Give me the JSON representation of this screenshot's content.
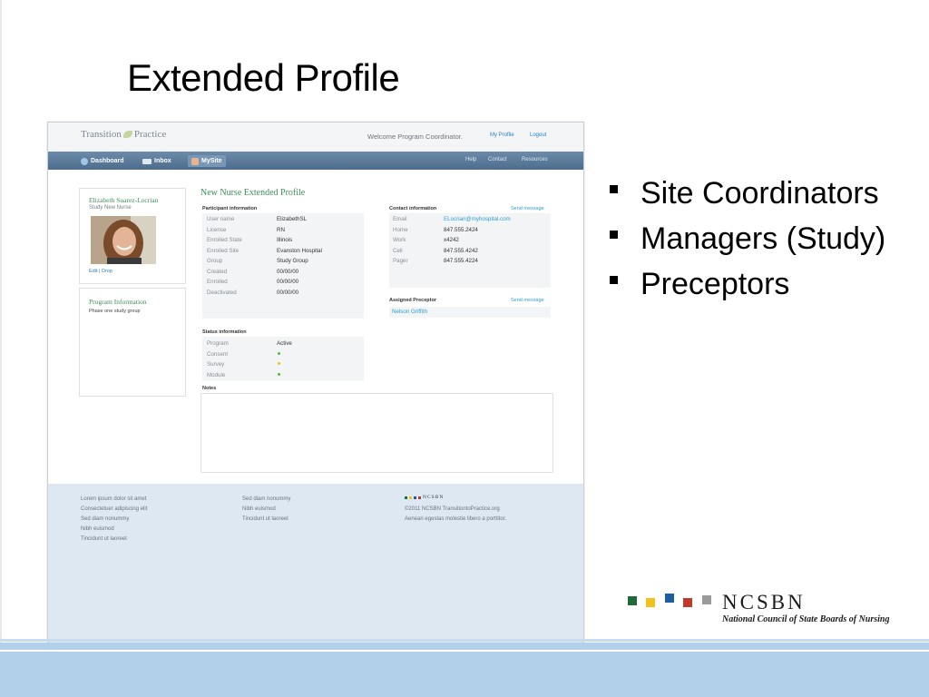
{
  "slide": {
    "title": "Extended Profile",
    "bullets": [
      "Site Coordinators",
      "Managers (Study)",
      "Preceptors"
    ]
  },
  "app": {
    "brand_left": "Transition",
    "brand_right": "Practice",
    "welcome": "Welcome Program Coordinator.",
    "top_links": [
      "My Profile",
      "Logout"
    ],
    "nav": [
      "Dashboard",
      "Inbox",
      "MySite"
    ],
    "nav_right": [
      "Help",
      "Contact",
      "Resources"
    ]
  },
  "sidebar": {
    "name": "Elizabeth Suarez-Locrian",
    "role": "Study New Nurse",
    "edit": "Edit",
    "drop": "Drop",
    "program_title": "Program Information",
    "program_text": "Phase one study group"
  },
  "profile": {
    "title": "New Nurse Extended Profile",
    "participant_header": "Participant information",
    "participant": [
      {
        "label": "User name",
        "value": "ElizabethSL"
      },
      {
        "label": "License",
        "value": "RN"
      },
      {
        "label": "Enrolled State",
        "value": "Illinois"
      },
      {
        "label": "Enrolled Site",
        "value": "Evanston Hospital"
      },
      {
        "label": "Group",
        "value": "Study Group"
      },
      {
        "label": "Created",
        "value": "00/00/00"
      },
      {
        "label": "Enrolled",
        "value": "00/00/00"
      },
      {
        "label": "Deactivated",
        "value": "00/00/00"
      }
    ],
    "contact_header": "Contact information",
    "contact_send": "Send message",
    "contact": [
      {
        "label": "Email",
        "value": "ELocrian@myhospital.com"
      },
      {
        "label": "Home",
        "value": "847.555.2424"
      },
      {
        "label": "Work",
        "value": "x4242"
      },
      {
        "label": "Cell",
        "value": "847.555.4242"
      },
      {
        "label": "Pager",
        "value": "847.555.4224"
      }
    ],
    "preceptor_header": "Assigned Preceptor",
    "preceptor_send": "Send message",
    "preceptor": "Nelson Griffith",
    "status_header": "Status information",
    "status": [
      {
        "label": "Program",
        "value": "Active",
        "dot": ""
      },
      {
        "label": "Consent",
        "value": "",
        "dot": "#44c23d"
      },
      {
        "label": "Survey",
        "value": "",
        "dot": "#f2c21a"
      },
      {
        "label": "Module",
        "value": "",
        "dot": "#44c23d"
      }
    ],
    "notes_header": "Notes"
  },
  "footer": {
    "col1": [
      "Lorem ipsum dolor sit amet",
      "Consectetuer adipiscing elit",
      "Sed diam nonummy",
      "Nibh euismod",
      "Tincidunt ut laoreet"
    ],
    "col2": [
      "Sed diam nonummy",
      "Nibh euismod",
      "Tincidunt ut laoreet"
    ],
    "logo": "NCSBN",
    "col3": [
      "©2011 NCSBN TransitiontoPractice.org",
      "Aenean egestas molestie libero a porttitor."
    ]
  },
  "logo": {
    "word": "NCSBN",
    "subtitle": "National Council of State Boards of Nursing",
    "square_colors": [
      "#1f6a3a",
      "#f2c21a",
      "#1b5f9e",
      "#c2392b",
      "#9a9a9a"
    ]
  }
}
